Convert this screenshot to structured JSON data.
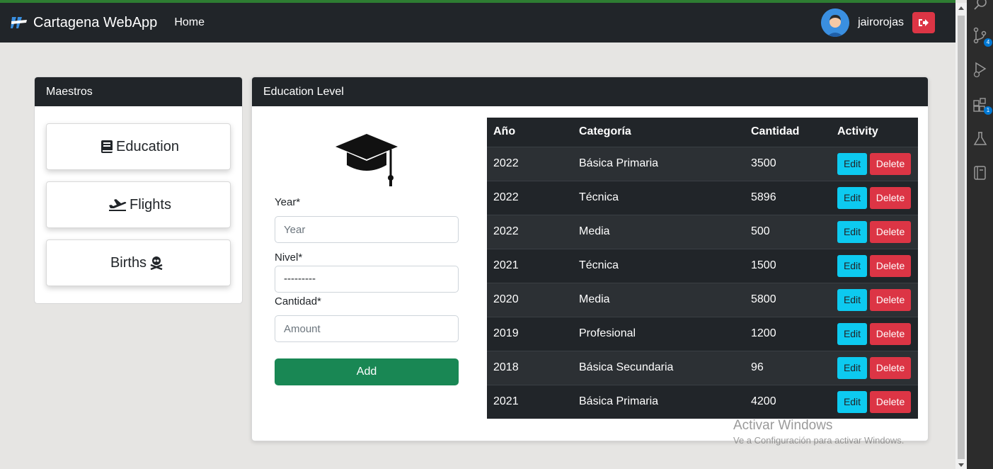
{
  "navbar": {
    "brand": "Cartagena WebApp",
    "home": "Home",
    "username": "jairorojas"
  },
  "maestros": {
    "title": "Maestros",
    "education": "Education",
    "flights": "Flights",
    "births": "Births"
  },
  "education": {
    "title": "Education Level",
    "form": {
      "year_label": "Year*",
      "year_placeholder": "Year",
      "nivel_label": "Nivel*",
      "nivel_value": "---------",
      "cantidad_label": "Cantidad*",
      "cantidad_placeholder": "Amount",
      "add_label": "Add"
    },
    "table": {
      "headers": [
        "Año",
        "Categoría",
        "Cantidad",
        "Activity"
      ],
      "edit_label": "Edit",
      "delete_label": "Delete",
      "rows": [
        [
          "2022",
          "Básica Primaria",
          "3500"
        ],
        [
          "2022",
          "Técnica",
          "5896"
        ],
        [
          "2022",
          "Media",
          "500"
        ],
        [
          "2021",
          "Técnica",
          "1500"
        ],
        [
          "2020",
          "Media",
          "5800"
        ],
        [
          "2019",
          "Profesional",
          "1200"
        ],
        [
          "2018",
          "Básica Secundaria",
          "96"
        ],
        [
          "2021",
          "Básica Primaria",
          "4200"
        ]
      ]
    }
  },
  "activitybar": {
    "scm_badge": "4",
    "extensions_badge": "1"
  },
  "watermark": {
    "title": "Activar Windows",
    "subtitle": "Ve a Configuración para activar Windows."
  },
  "colors": {
    "navbar": "#212529",
    "edit": "#0dcaf0",
    "delete": "#dc3545",
    "add": "#198754"
  }
}
